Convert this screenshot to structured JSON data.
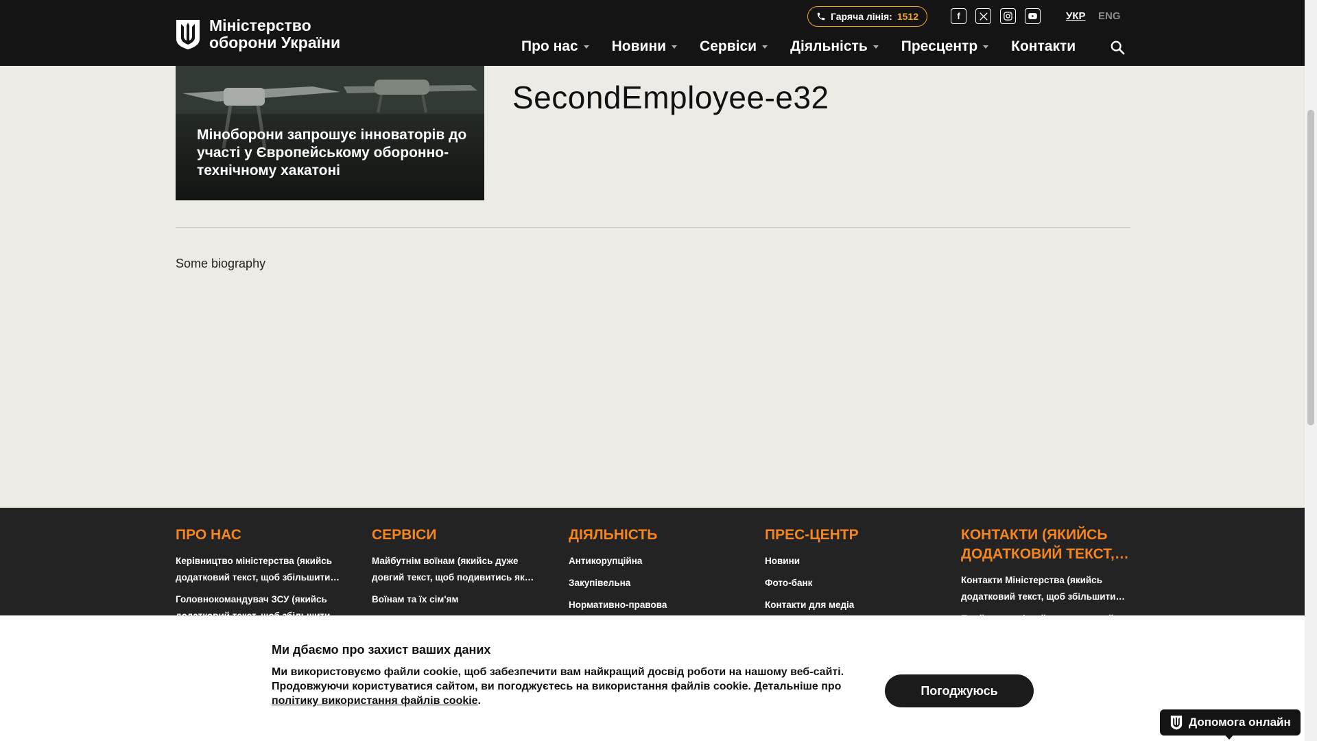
{
  "header": {
    "logo_line1": "Міністерство",
    "logo_line2": "оборони України",
    "hotline_label": "Гаряча лінія:",
    "hotline_number": "1512",
    "socials": [
      "facebook-icon",
      "x-twitter-icon",
      "instagram-icon",
      "youtube-icon"
    ],
    "lang_active": "УКР",
    "lang_other": "ENG",
    "nav": [
      {
        "label": "Про нас",
        "has_dropdown": true
      },
      {
        "label": "Новини",
        "has_dropdown": true
      },
      {
        "label": "Сервіси",
        "has_dropdown": true
      },
      {
        "label": "Діяльність",
        "has_dropdown": true
      },
      {
        "label": "Пресцентр",
        "has_dropdown": true
      },
      {
        "label": "Контакти",
        "has_dropdown": false
      }
    ]
  },
  "main": {
    "news_card_title": "Міноборони запрошує інноваторів до участі у Європейському оборонно-технічному хакатоні",
    "page_heading": "SecondEmployee-e32",
    "biography": "Some biography"
  },
  "footer": {
    "columns": [
      {
        "title": "ПРО НАС",
        "links": [
          "Керівництво міністерства (якийсь додатковий текст, щоб збільшити…",
          "Головнокомандувач ЗСУ (якийсь додатковий текст, щоб збільшити…"
        ]
      },
      {
        "title": "СЕРВІСИ",
        "links": [
          "Майбутнім воїнам (якийсь дуже довгий текст, щоб подивитись як…",
          "Воїнам та їх сім'ям"
        ]
      },
      {
        "title": "ДІЯЛЬНІСТЬ",
        "links": [
          "Антикорупційна",
          "Закупівельна",
          "Нормативно-правова"
        ]
      },
      {
        "title": "ПРЕС-ЦЕНТР",
        "links": [
          "Новини",
          "Фото-банк",
          "Контакти для медіа"
        ]
      },
      {
        "title": "КОНТАКТИ (ЯКИЙСЬ ДОДАТКОВИЙ ТЕКСТ,…",
        "links": [
          "Контакти Міністерства (якийсь додатковий текст, щоб збільшити…",
          "Приймальня (якийсь додатковий"
        ]
      }
    ]
  },
  "cookie": {
    "title": "Ми дбаємо про захист ваших даних",
    "text": "Ми використовуємо файли cookie, щоб забезпечити вам найкращий досвід роботи на нашому веб-сайті. Продовжуючи користуватися сайтом, ви погоджуєтесь на використання файлів cookie. Детальніше про",
    "policy_link": "політику використання файлів cookie",
    "button": "Погоджуюсь"
  },
  "help_button": "Допомога онлайн",
  "colors": {
    "accent": "#f5861f",
    "header_bg": "#141414",
    "page_bg": "#edebe6",
    "footer_bg": "#232323"
  }
}
